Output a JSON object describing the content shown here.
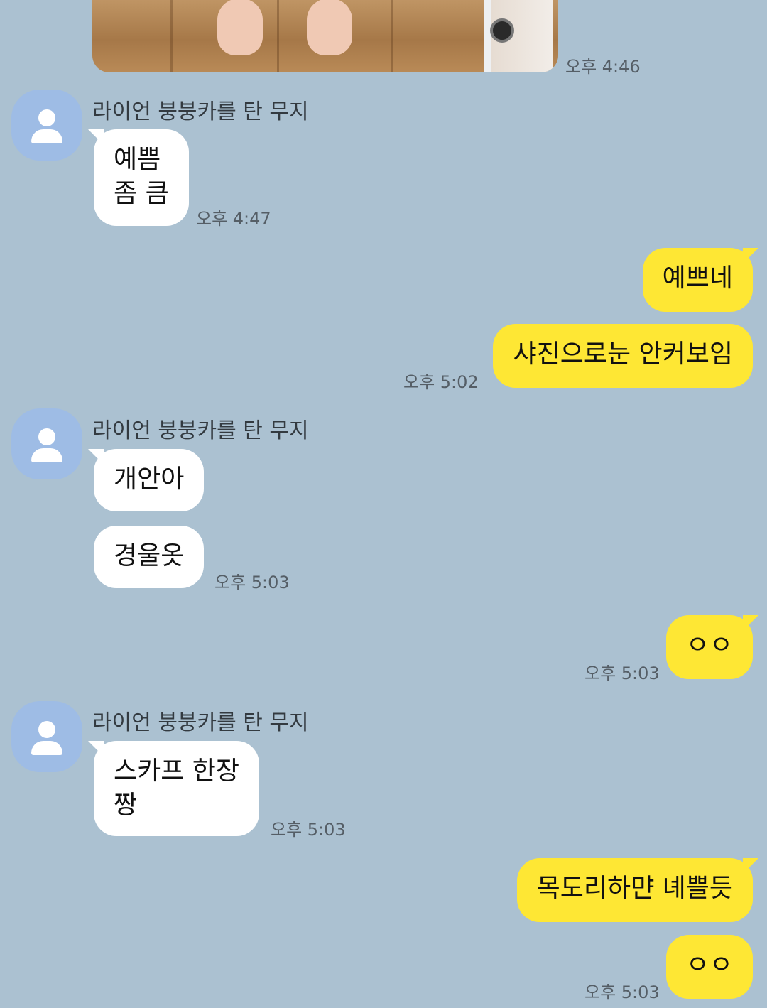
{
  "colors": {
    "background": "#abc1d1",
    "incoming_bubble": "#ffffff",
    "outgoing_bubble": "#fee734",
    "avatar": "#9ebce5"
  },
  "photo_message": {
    "time": "오후 4:46"
  },
  "groups": [
    {
      "sender": "라이언 붕붕카를 탄 무지",
      "messages": [
        {
          "lines": [
            "예쁨",
            "좀 큼"
          ]
        }
      ],
      "time": "오후 4:47"
    },
    {
      "direction": "out",
      "messages": [
        {
          "text": "예쁘네"
        },
        {
          "text": "샤진으로눈 안커보임"
        }
      ],
      "time": "오후 5:02"
    },
    {
      "sender": "라이언 붕붕카를 탄 무지",
      "messages": [
        {
          "text": "개안아"
        },
        {
          "text": "경울옷"
        }
      ],
      "time": "오후 5:03"
    },
    {
      "direction": "out",
      "messages": [
        {
          "text": "ㅇㅇ"
        }
      ],
      "time": "오후 5:03"
    },
    {
      "sender": "라이언 붕붕카를 탄 무지",
      "messages": [
        {
          "lines": [
            "스카프 한장",
            "짱"
          ]
        }
      ],
      "time": "오후 5:03"
    },
    {
      "direction": "out",
      "messages": [
        {
          "text": "목도리하먄 녜쁠듯"
        },
        {
          "text": "ㅇㅇ"
        }
      ],
      "time": "오후 5:03"
    }
  ]
}
